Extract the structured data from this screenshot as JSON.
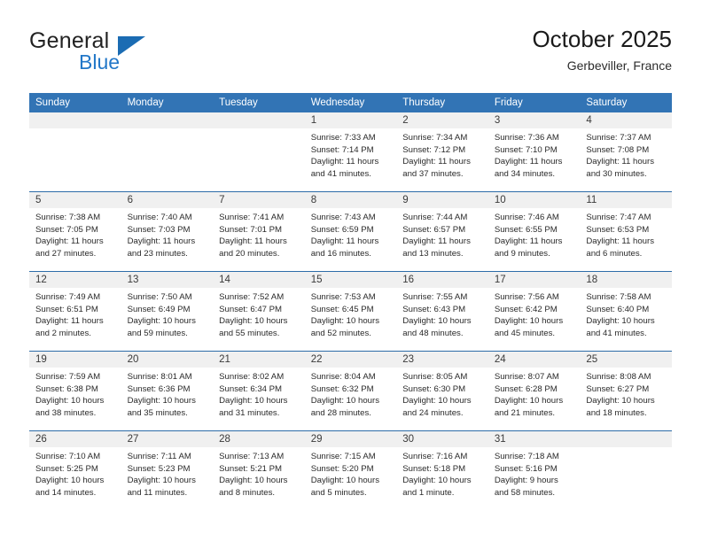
{
  "brand": {
    "line1": "General",
    "line2": "Blue",
    "accent_color": "#1b6cb3"
  },
  "header": {
    "title": "October 2025",
    "location": "Gerbeviller, France",
    "header_bg": "#3274b5",
    "row_divider": "#2d6ca8",
    "daynum_bg": "#f0f0f0"
  },
  "weekdays": [
    "Sunday",
    "Monday",
    "Tuesday",
    "Wednesday",
    "Thursday",
    "Friday",
    "Saturday"
  ],
  "labels": {
    "sunrise": "Sunrise:",
    "sunset": "Sunset:",
    "daylight": "Daylight:"
  },
  "weeks": [
    [
      {
        "day": "",
        "sunrise": "",
        "sunset": "",
        "daylight1": "",
        "daylight2": ""
      },
      {
        "day": "",
        "sunrise": "",
        "sunset": "",
        "daylight1": "",
        "daylight2": ""
      },
      {
        "day": "",
        "sunrise": "",
        "sunset": "",
        "daylight1": "",
        "daylight2": ""
      },
      {
        "day": "1",
        "sunrise": "Sunrise: 7:33 AM",
        "sunset": "Sunset: 7:14 PM",
        "daylight1": "Daylight: 11 hours",
        "daylight2": "and 41 minutes."
      },
      {
        "day": "2",
        "sunrise": "Sunrise: 7:34 AM",
        "sunset": "Sunset: 7:12 PM",
        "daylight1": "Daylight: 11 hours",
        "daylight2": "and 37 minutes."
      },
      {
        "day": "3",
        "sunrise": "Sunrise: 7:36 AM",
        "sunset": "Sunset: 7:10 PM",
        "daylight1": "Daylight: 11 hours",
        "daylight2": "and 34 minutes."
      },
      {
        "day": "4",
        "sunrise": "Sunrise: 7:37 AM",
        "sunset": "Sunset: 7:08 PM",
        "daylight1": "Daylight: 11 hours",
        "daylight2": "and 30 minutes."
      }
    ],
    [
      {
        "day": "5",
        "sunrise": "Sunrise: 7:38 AM",
        "sunset": "Sunset: 7:05 PM",
        "daylight1": "Daylight: 11 hours",
        "daylight2": "and 27 minutes."
      },
      {
        "day": "6",
        "sunrise": "Sunrise: 7:40 AM",
        "sunset": "Sunset: 7:03 PM",
        "daylight1": "Daylight: 11 hours",
        "daylight2": "and 23 minutes."
      },
      {
        "day": "7",
        "sunrise": "Sunrise: 7:41 AM",
        "sunset": "Sunset: 7:01 PM",
        "daylight1": "Daylight: 11 hours",
        "daylight2": "and 20 minutes."
      },
      {
        "day": "8",
        "sunrise": "Sunrise: 7:43 AM",
        "sunset": "Sunset: 6:59 PM",
        "daylight1": "Daylight: 11 hours",
        "daylight2": "and 16 minutes."
      },
      {
        "day": "9",
        "sunrise": "Sunrise: 7:44 AM",
        "sunset": "Sunset: 6:57 PM",
        "daylight1": "Daylight: 11 hours",
        "daylight2": "and 13 minutes."
      },
      {
        "day": "10",
        "sunrise": "Sunrise: 7:46 AM",
        "sunset": "Sunset: 6:55 PM",
        "daylight1": "Daylight: 11 hours",
        "daylight2": "and 9 minutes."
      },
      {
        "day": "11",
        "sunrise": "Sunrise: 7:47 AM",
        "sunset": "Sunset: 6:53 PM",
        "daylight1": "Daylight: 11 hours",
        "daylight2": "and 6 minutes."
      }
    ],
    [
      {
        "day": "12",
        "sunrise": "Sunrise: 7:49 AM",
        "sunset": "Sunset: 6:51 PM",
        "daylight1": "Daylight: 11 hours",
        "daylight2": "and 2 minutes."
      },
      {
        "day": "13",
        "sunrise": "Sunrise: 7:50 AM",
        "sunset": "Sunset: 6:49 PM",
        "daylight1": "Daylight: 10 hours",
        "daylight2": "and 59 minutes."
      },
      {
        "day": "14",
        "sunrise": "Sunrise: 7:52 AM",
        "sunset": "Sunset: 6:47 PM",
        "daylight1": "Daylight: 10 hours",
        "daylight2": "and 55 minutes."
      },
      {
        "day": "15",
        "sunrise": "Sunrise: 7:53 AM",
        "sunset": "Sunset: 6:45 PM",
        "daylight1": "Daylight: 10 hours",
        "daylight2": "and 52 minutes."
      },
      {
        "day": "16",
        "sunrise": "Sunrise: 7:55 AM",
        "sunset": "Sunset: 6:43 PM",
        "daylight1": "Daylight: 10 hours",
        "daylight2": "and 48 minutes."
      },
      {
        "day": "17",
        "sunrise": "Sunrise: 7:56 AM",
        "sunset": "Sunset: 6:42 PM",
        "daylight1": "Daylight: 10 hours",
        "daylight2": "and 45 minutes."
      },
      {
        "day": "18",
        "sunrise": "Sunrise: 7:58 AM",
        "sunset": "Sunset: 6:40 PM",
        "daylight1": "Daylight: 10 hours",
        "daylight2": "and 41 minutes."
      }
    ],
    [
      {
        "day": "19",
        "sunrise": "Sunrise: 7:59 AM",
        "sunset": "Sunset: 6:38 PM",
        "daylight1": "Daylight: 10 hours",
        "daylight2": "and 38 minutes."
      },
      {
        "day": "20",
        "sunrise": "Sunrise: 8:01 AM",
        "sunset": "Sunset: 6:36 PM",
        "daylight1": "Daylight: 10 hours",
        "daylight2": "and 35 minutes."
      },
      {
        "day": "21",
        "sunrise": "Sunrise: 8:02 AM",
        "sunset": "Sunset: 6:34 PM",
        "daylight1": "Daylight: 10 hours",
        "daylight2": "and 31 minutes."
      },
      {
        "day": "22",
        "sunrise": "Sunrise: 8:04 AM",
        "sunset": "Sunset: 6:32 PM",
        "daylight1": "Daylight: 10 hours",
        "daylight2": "and 28 minutes."
      },
      {
        "day": "23",
        "sunrise": "Sunrise: 8:05 AM",
        "sunset": "Sunset: 6:30 PM",
        "daylight1": "Daylight: 10 hours",
        "daylight2": "and 24 minutes."
      },
      {
        "day": "24",
        "sunrise": "Sunrise: 8:07 AM",
        "sunset": "Sunset: 6:28 PM",
        "daylight1": "Daylight: 10 hours",
        "daylight2": "and 21 minutes."
      },
      {
        "day": "25",
        "sunrise": "Sunrise: 8:08 AM",
        "sunset": "Sunset: 6:27 PM",
        "daylight1": "Daylight: 10 hours",
        "daylight2": "and 18 minutes."
      }
    ],
    [
      {
        "day": "26",
        "sunrise": "Sunrise: 7:10 AM",
        "sunset": "Sunset: 5:25 PM",
        "daylight1": "Daylight: 10 hours",
        "daylight2": "and 14 minutes."
      },
      {
        "day": "27",
        "sunrise": "Sunrise: 7:11 AM",
        "sunset": "Sunset: 5:23 PM",
        "daylight1": "Daylight: 10 hours",
        "daylight2": "and 11 minutes."
      },
      {
        "day": "28",
        "sunrise": "Sunrise: 7:13 AM",
        "sunset": "Sunset: 5:21 PM",
        "daylight1": "Daylight: 10 hours",
        "daylight2": "and 8 minutes."
      },
      {
        "day": "29",
        "sunrise": "Sunrise: 7:15 AM",
        "sunset": "Sunset: 5:20 PM",
        "daylight1": "Daylight: 10 hours",
        "daylight2": "and 5 minutes."
      },
      {
        "day": "30",
        "sunrise": "Sunrise: 7:16 AM",
        "sunset": "Sunset: 5:18 PM",
        "daylight1": "Daylight: 10 hours",
        "daylight2": "and 1 minute."
      },
      {
        "day": "31",
        "sunrise": "Sunrise: 7:18 AM",
        "sunset": "Sunset: 5:16 PM",
        "daylight1": "Daylight: 9 hours",
        "daylight2": "and 58 minutes."
      },
      {
        "day": "",
        "sunrise": "",
        "sunset": "",
        "daylight1": "",
        "daylight2": ""
      }
    ]
  ]
}
